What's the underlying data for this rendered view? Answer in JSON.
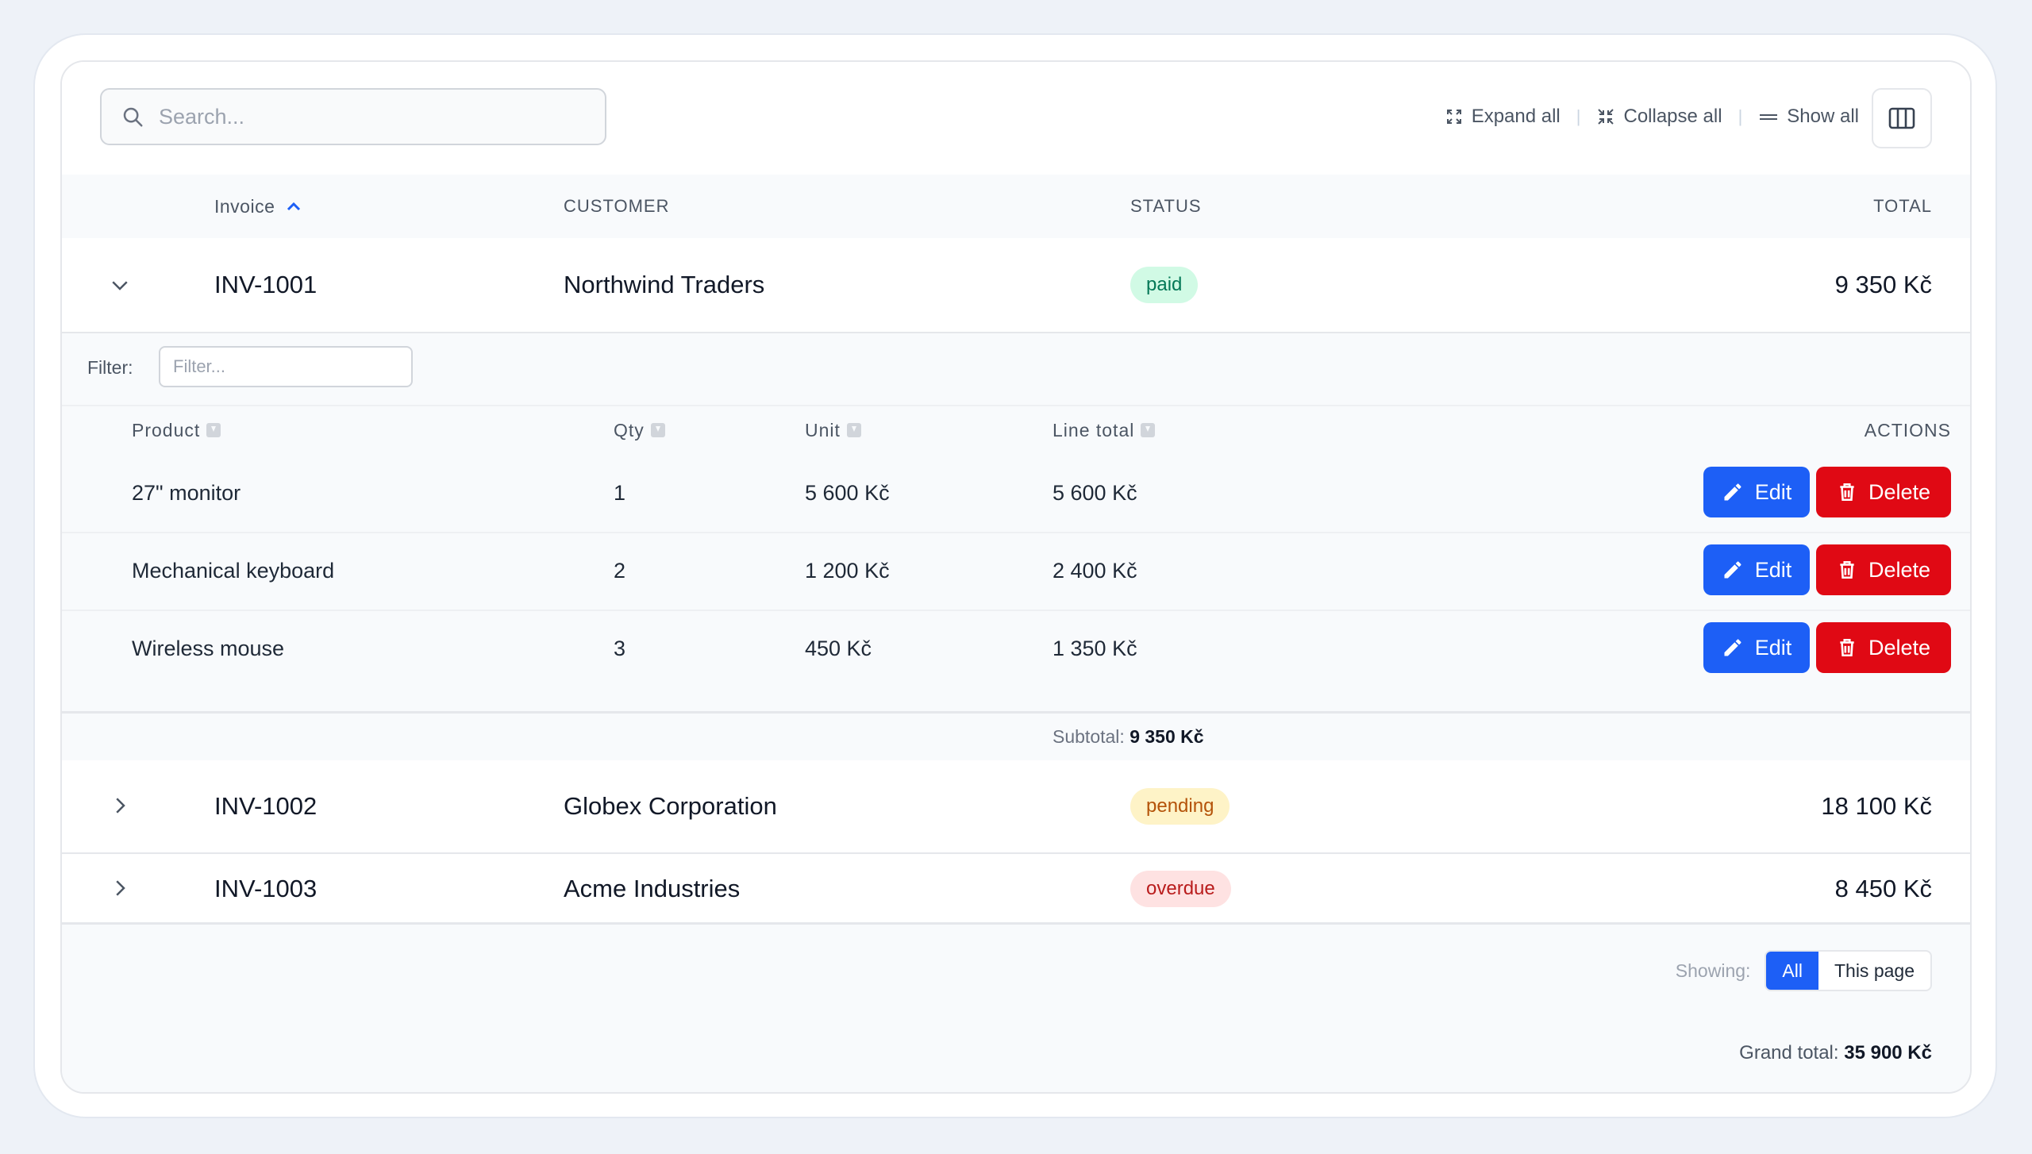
{
  "toolbar": {
    "search_placeholder": "Search...",
    "expand_all": "Expand all",
    "collapse_all": "Collapse all",
    "show_all": "Show all"
  },
  "table": {
    "columns": {
      "invoice": "Invoice",
      "customer": "CUSTOMER",
      "status": "STATUS",
      "total": "TOTAL"
    },
    "rows": [
      {
        "invoice": "INV-1001",
        "customer": "Northwind Traders",
        "status": "paid",
        "total": "9 350 Kč",
        "expanded": true
      },
      {
        "invoice": "INV-1002",
        "customer": "Globex Corporation",
        "status": "pending",
        "total": "18 100 Kč",
        "expanded": false
      },
      {
        "invoice": "INV-1003",
        "customer": "Acme Industries",
        "status": "overdue",
        "total": "8 450 Kč",
        "expanded": false
      }
    ]
  },
  "detail": {
    "filter_label": "Filter:",
    "filter_placeholder": "Filter...",
    "columns": {
      "product": "Product",
      "qty": "Qty",
      "unit": "Unit",
      "line_total": "Line total",
      "actions": "ACTIONS"
    },
    "items": [
      {
        "product": "27\" monitor",
        "qty": "1",
        "unit": "5 600 Kč",
        "line_total": "5 600 Kč"
      },
      {
        "product": "Mechanical keyboard",
        "qty": "2",
        "unit": "1 200 Kč",
        "line_total": "2 400 Kč"
      },
      {
        "product": "Wireless mouse",
        "qty": "3",
        "unit": "450 Kč",
        "line_total": "1 350 Kč"
      }
    ],
    "edit_label": "Edit",
    "delete_label": "Delete",
    "subtotal_label": "Subtotal:",
    "subtotal_value": "9 350 Kč"
  },
  "footer": {
    "showing_label": "Showing:",
    "options": [
      "All",
      "This page"
    ],
    "selected": "All",
    "grand_total_label": "Grand total:",
    "grand_total_value": "35 900 Kč"
  },
  "colors": {
    "accent": "#1d5ff6",
    "danger": "#e00914",
    "paid_bg": "#d1fae5",
    "pending_bg": "#fef3c7",
    "overdue_bg": "#fee2e2"
  }
}
